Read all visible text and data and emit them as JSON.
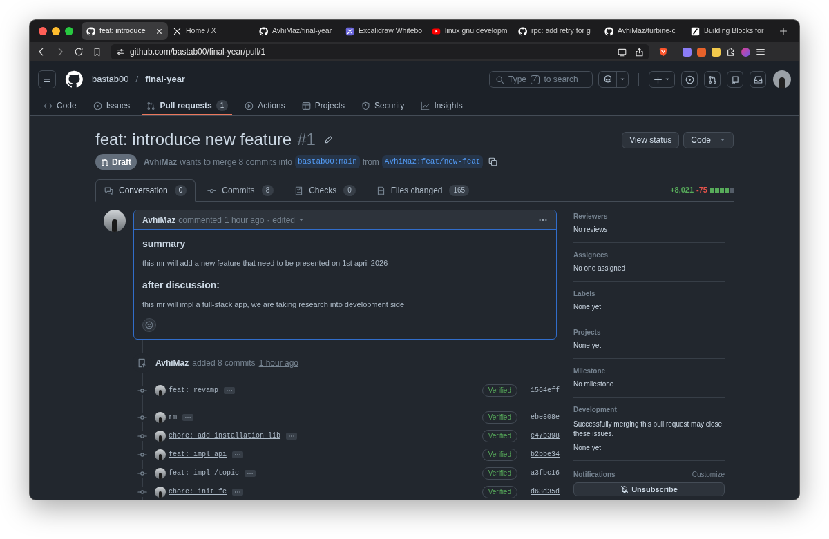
{
  "browser": {
    "tabs": [
      {
        "title": "feat: introduce",
        "kind": "github",
        "selected": true
      },
      {
        "title": "Home / X",
        "kind": "x",
        "selected": false
      },
      {
        "title": "AvhiMaz/final-year",
        "kind": "github",
        "selected": false
      },
      {
        "title": "Excalidraw Whitebo",
        "kind": "excalidraw",
        "selected": false
      },
      {
        "title": "linux gnu developm",
        "kind": "youtube",
        "selected": false
      },
      {
        "title": "rpc: add retry for g",
        "kind": "github",
        "selected": false
      },
      {
        "title": "AvhiMaz/turbine-c",
        "kind": "github",
        "selected": false
      },
      {
        "title": "Building Blocks for",
        "kind": "slash",
        "selected": false
      }
    ],
    "url": "github.com/bastab00/final-year/pull/1"
  },
  "repo": {
    "owner": "bastab00",
    "separator": "/",
    "name": "final-year"
  },
  "search": {
    "before": "Type",
    "key": "/",
    "after": "to search"
  },
  "repo_nav": [
    {
      "label": "Code",
      "kind": "code",
      "selected": false
    },
    {
      "label": "Issues",
      "kind": "issues",
      "selected": false
    },
    {
      "label": "Pull requests",
      "kind": "pulls",
      "count": "1",
      "selected": true
    },
    {
      "label": "Actions",
      "kind": "actions",
      "selected": false
    },
    {
      "label": "Projects",
      "kind": "projects",
      "selected": false
    },
    {
      "label": "Security",
      "kind": "security",
      "selected": false
    },
    {
      "label": "Insights",
      "kind": "insights",
      "selected": false
    }
  ],
  "pr": {
    "title": "feat: introduce new feature",
    "number": "#1",
    "state": "Draft",
    "author": "AvhiMaz",
    "merge_text": "wants to merge 8 commits into",
    "base": "bastab00:main",
    "from": "from",
    "head": "AvhiMaz:feat/new-feat"
  },
  "actions": [
    "View status",
    "Code"
  ],
  "pr_tabs": [
    {
      "label": "Conversation",
      "kind": "conversation",
      "count": "0",
      "selected": true
    },
    {
      "label": "Commits",
      "kind": "commits",
      "count": "8",
      "selected": false
    },
    {
      "label": "Checks",
      "kind": "checks",
      "count": "0",
      "selected": false
    },
    {
      "label": "Files changed",
      "kind": "files",
      "count": "165",
      "selected": false
    }
  ],
  "diffstat": {
    "additions": "+8,021",
    "deletions": "-75",
    "squares": [
      {
        "kind": "added"
      },
      {
        "kind": "added"
      },
      {
        "kind": "added"
      },
      {
        "kind": "added"
      },
      {
        "kind": "neutral"
      }
    ]
  },
  "comment": {
    "author": "AvhiMaz",
    "action": "commented",
    "time": "1 hour ago",
    "separator": "·",
    "edited": "edited",
    "body": [
      {
        "kind": "heading",
        "text": "summary"
      },
      {
        "kind": "paragraph",
        "text": "this mr will add a new feature that need to be presented on 1st april 2026"
      },
      {
        "kind": "heading",
        "text": "after discussion:"
      },
      {
        "kind": "paragraph",
        "text": "this mr will impl a full-stack app, we are taking research into development side"
      }
    ]
  },
  "commit_event": {
    "author": "AvhiMaz",
    "text": "added 8 commits",
    "time": "1 hour ago"
  },
  "commits": [
    {
      "message": "feat: revamp",
      "verified": "Verified",
      "sha": "1564eff"
    },
    {
      "message": "rm",
      "verified": "Verified",
      "sha": "ebe808e"
    },
    {
      "message": "chore: add installation lib",
      "verified": "Verified",
      "sha": "c47b398"
    },
    {
      "message": "feat: impl api",
      "verified": "Verified",
      "sha": "b2bbe34"
    },
    {
      "message": "feat: impl /topic",
      "verified": "Verified",
      "sha": "a3fbc16"
    },
    {
      "message": "chore: init fe",
      "verified": "Verified",
      "sha": "d63d35d"
    }
  ],
  "sidebar": [
    {
      "title": "Reviewers",
      "value": "No reviews"
    },
    {
      "title": "Assignees",
      "value": "No one assigned"
    },
    {
      "title": "Labels",
      "value": "None yet"
    },
    {
      "title": "Projects",
      "value": "None yet"
    },
    {
      "title": "Milestone",
      "value": "No milestone"
    },
    {
      "title": "Development",
      "note": "Successfully merging this pull request may close these issues.",
      "value": "None yet"
    }
  ],
  "notifications": {
    "title": "Notifications",
    "action": "Customize",
    "button": "Unsubscribe"
  }
}
